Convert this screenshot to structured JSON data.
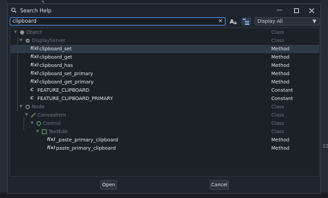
{
  "window": {
    "title": "Search Help"
  },
  "search": {
    "value": "clipboard"
  },
  "filter": {
    "selected": "Display All"
  },
  "results": [
    {
      "name": "Object",
      "type": "Class",
      "dim": true,
      "indent": 0,
      "kind": "object"
    },
    {
      "name": "DisplayServer",
      "type": "Class",
      "dim": true,
      "indent": 1,
      "kind": "display-server"
    },
    {
      "name": "clipboard_set",
      "type": "Method",
      "dim": false,
      "indent": 2,
      "kind": "method",
      "selected": true
    },
    {
      "name": "clipboard_get",
      "type": "Method",
      "dim": false,
      "indent": 2,
      "kind": "method"
    },
    {
      "name": "clipboard_has",
      "type": "Method",
      "dim": false,
      "indent": 2,
      "kind": "method"
    },
    {
      "name": "clipboard_set_primary",
      "type": "Method",
      "dim": false,
      "indent": 2,
      "kind": "method"
    },
    {
      "name": "clipboard_get_primary",
      "type": "Method",
      "dim": false,
      "indent": 2,
      "kind": "method"
    },
    {
      "name": "FEATURE_CLIPBOARD",
      "type": "Constant",
      "dim": false,
      "indent": 2,
      "kind": "constant"
    },
    {
      "name": "FEATURE_CLIPBOARD_PRIMARY",
      "type": "Constant",
      "dim": false,
      "indent": 2,
      "kind": "constant"
    },
    {
      "name": "Node",
      "type": "Class",
      "dim": true,
      "indent": 1,
      "kind": "node"
    },
    {
      "name": "CanvasItem",
      "type": "Class",
      "dim": true,
      "indent": 2,
      "kind": "canvas-item"
    },
    {
      "name": "Control",
      "type": "Class",
      "dim": true,
      "indent": 3,
      "kind": "control"
    },
    {
      "name": "TextEdit",
      "type": "Class",
      "dim": true,
      "indent": 4,
      "kind": "text-edit"
    },
    {
      "name": "_paste_primary_clipboard",
      "type": "Method",
      "dim": false,
      "indent": 5,
      "kind": "method"
    },
    {
      "name": "paste_primary_clipboard",
      "type": "Method",
      "dim": false,
      "indent": 5,
      "kind": "method"
    }
  ],
  "buttons": {
    "open": "Open",
    "cancel": "Cancel"
  },
  "background": {
    "tag_top": "5",
    "tag_right": "32"
  },
  "colors": {
    "accent": "#4d8fd6",
    "selected_row": "#2f3a48",
    "control_green": "#8eef97",
    "canvas_item_green": "#9cd06e"
  }
}
